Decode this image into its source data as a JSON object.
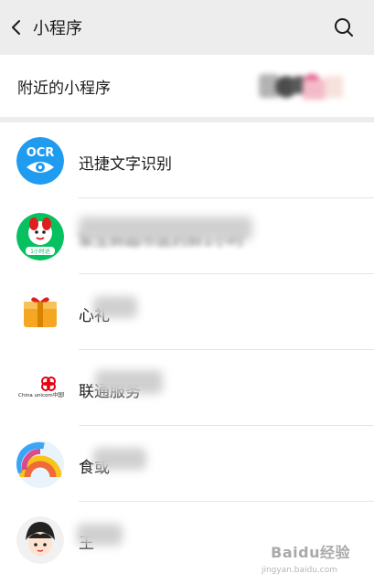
{
  "header": {
    "title": "小程序",
    "back_icon": "chevron-left-icon",
    "search_icon": "search-icon"
  },
  "nearby": {
    "label": "附近的小程序"
  },
  "apps": [
    {
      "label": "迅捷文字识别",
      "icon": "ocr-eye-icon",
      "icon_text": "OCR"
    },
    {
      "label": "家生鲜超市医药鲜1小时",
      "icon": "mascot-dog-icon",
      "icon_text": "1小时达"
    },
    {
      "label": "心礼",
      "icon": "gift-box-icon"
    },
    {
      "label": "联通服务",
      "icon": "china-unicom-logo-icon",
      "icon_text": "China unicom中国联通"
    },
    {
      "label": "食或",
      "icon": "rainbow-icon"
    },
    {
      "label": "王",
      "icon": "anime-avatar-icon"
    }
  ],
  "colors": {
    "background": "#ededed",
    "ocr_blue": "#1f9cf0",
    "green": "#07c160",
    "unicom_red": "#e60012",
    "gift_orange": "#f5a623"
  },
  "watermark": {
    "text": "Baidu经验",
    "sub": "jingyan.baidu.com"
  }
}
